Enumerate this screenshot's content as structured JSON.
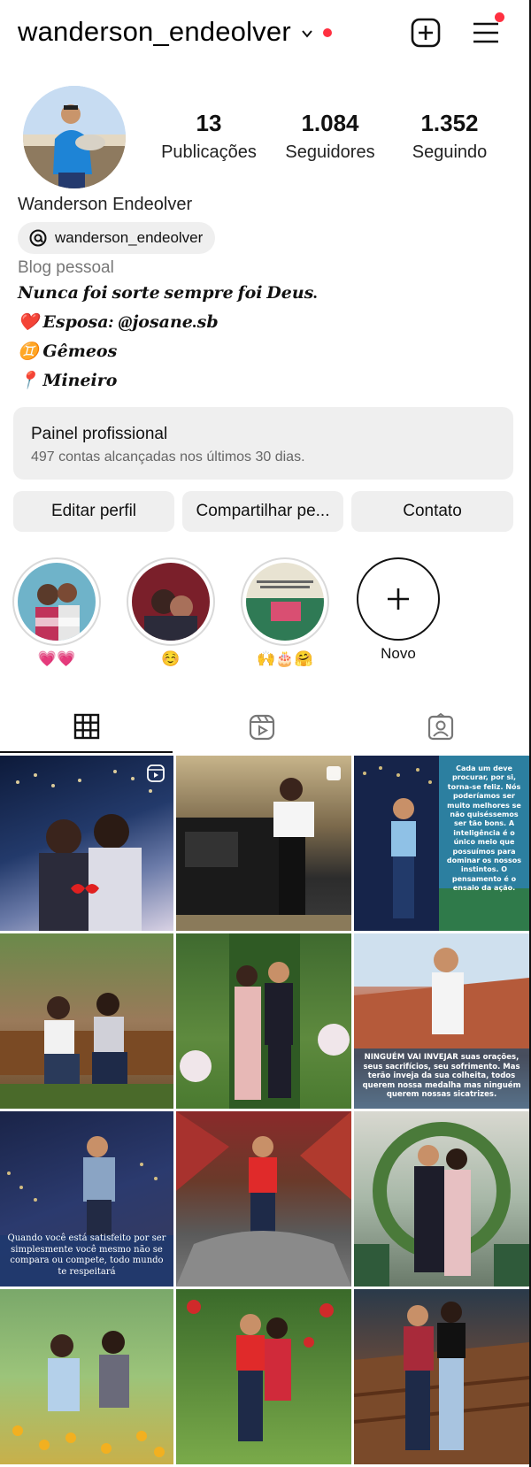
{
  "header": {
    "username": "wanderson_endeolver",
    "has_notification_dot": true
  },
  "profile": {
    "stats": [
      {
        "value": "13",
        "label": "Publicações"
      },
      {
        "value": "1.084",
        "label": "Seguidores"
      },
      {
        "value": "1.352",
        "label": "Seguindo"
      }
    ],
    "full_name": "Wanderson Endeolver",
    "threads_handle": "wanderson_endeolver",
    "category": "Blog pessoal",
    "bio_lines": [
      "𝑵𝒖𝒏𝒄𝒂 𝒇𝒐𝒊 𝒔𝒐𝒓𝒕𝒆 𝒔𝒆𝒎𝒑𝒓𝒆 𝒇𝒐𝒊 𝑫𝒆𝒖𝒔.",
      "❤️ 𝑬𝒔𝒑𝒐𝒔𝒂: @𝒋𝒐𝒔𝒂𝒏𝒆.𝒔𝒃",
      "♊ 𝑮𝒆̂𝒎𝒆𝒐𝒔",
      "📍 𝑴𝒊𝒏𝒆𝒊𝒓𝒐"
    ]
  },
  "dashboard": {
    "title": "Painel profissional",
    "subtitle": "497 contas alcançadas nos últimos 30 dias."
  },
  "actions": {
    "edit": "Editar perfil",
    "share": "Compartilhar pe...",
    "contact": "Contato"
  },
  "highlights": [
    {
      "label": "💗💗"
    },
    {
      "label": "☺️"
    },
    {
      "label": "🙌🎂🤗"
    },
    {
      "label": "Novo"
    }
  ],
  "tabs": [
    "grid-icon",
    "reels-icon",
    "tagged-icon"
  ],
  "posts": [
    {
      "caption": ""
    },
    {
      "caption": ""
    },
    {
      "caption": "Cada um deve procurar, por si, torna-se feliz. Nós poderíamos ser muito melhores se não quiséssemos ser tão bons. A inteligência é o único meio que possuímos para dominar os nossos instintos. O pensamento é o ensaio da ação."
    },
    {
      "caption": ""
    },
    {
      "caption": ""
    },
    {
      "caption": "NINGUÉM VAI INVEJAR suas orações, seus sacrifícios, seu sofrimento. Mas terão inveja da sua colheita, todos querem nossa medalha mas ninguém querem nossas sicatrizes."
    },
    {
      "caption": "Quando você está satisfeito por ser simplesmente você mesmo não se compara ou compete, todo mundo te respeitará"
    },
    {
      "caption": ""
    },
    {
      "caption": ""
    },
    {
      "caption": ""
    },
    {
      "caption": ""
    },
    {
      "caption": ""
    }
  ],
  "colors": {
    "accent": "#ff3040",
    "chip_bg": "#efefef"
  }
}
